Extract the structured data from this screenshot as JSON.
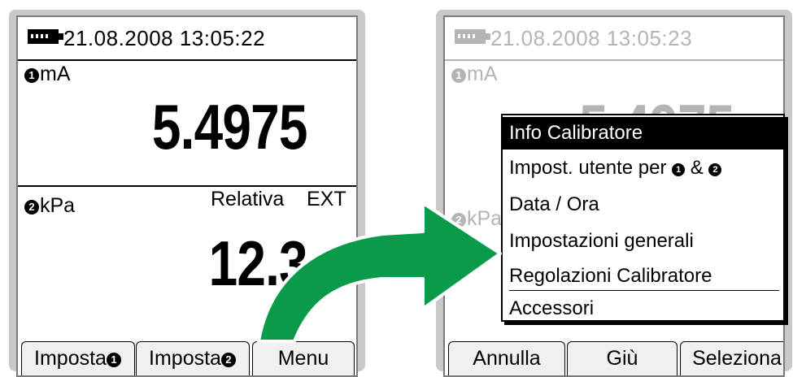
{
  "left": {
    "datetime": "21.08.2008  13:05:22",
    "ch1": {
      "num": "1",
      "unit": "mA",
      "value": "5.4975"
    },
    "ch2": {
      "num": "2",
      "unit": "kPa",
      "mode": "Relativa",
      "ext": "EXT",
      "value": "12.3"
    },
    "softkeys": [
      {
        "label": "Imposta",
        "num": "1"
      },
      {
        "label": "Imposta",
        "num": "2"
      },
      {
        "label": "Menu"
      }
    ]
  },
  "right": {
    "datetime": "21.08.2008  13:05:23",
    "ch1": {
      "num": "1",
      "unit": "mA",
      "value": "5.4975"
    },
    "ch2": {
      "num": "2",
      "unit": "kPa"
    },
    "menu": {
      "items": [
        "Info Calibratore",
        "Impost. utente per",
        "Data / Ora",
        "Impostazioni generali",
        "Regolazioni Calibratore",
        "Accessori"
      ],
      "selected_index": 0,
      "item_suffix": {
        "num1": "1",
        "amp": "&",
        "num2": "2"
      }
    },
    "softkeys": [
      "Annulla",
      "Giù",
      "Seleziona"
    ]
  },
  "colors": {
    "arrow": "#0a9a4a",
    "frame": "#c8c8c8",
    "dimmed_text": "#b4b4b4"
  }
}
